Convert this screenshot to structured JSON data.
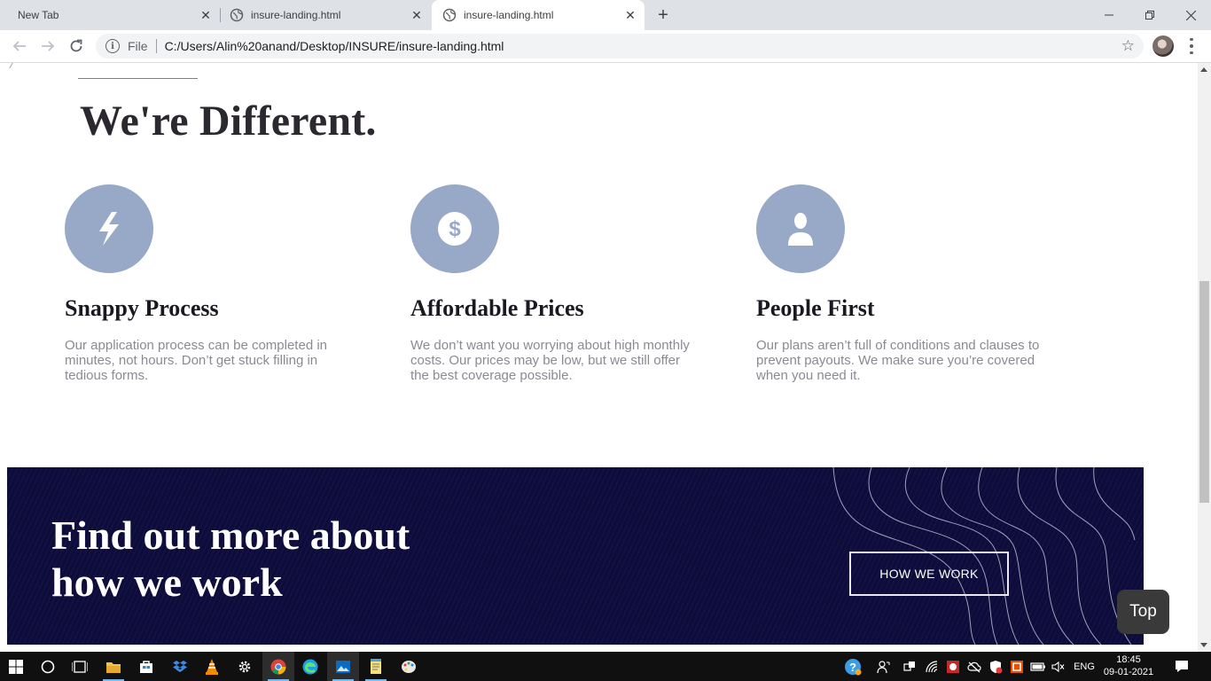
{
  "browser": {
    "tabs": [
      {
        "title": "New Tab"
      },
      {
        "title": "insure-landing.html"
      },
      {
        "title": "insure-landing.html"
      }
    ],
    "address": {
      "scheme_label": "File",
      "url": "C:/Users/Alin%20anand/Desktop/INSURE/insure-landing.html"
    }
  },
  "page": {
    "section_title": "We're Different.",
    "features": [
      {
        "icon": "lightning-icon",
        "title": "Snappy Process",
        "text": "Our application process can be completed in minutes, not hours. Don’t get stuck filling in tedious forms."
      },
      {
        "icon": "dollar-icon",
        "title": "Affordable Prices",
        "text": "We don’t want you worrying about high monthly costs. Our prices may be low, but we still offer the best coverage possible."
      },
      {
        "icon": "person-icon",
        "title": "People First",
        "text": "Our plans aren’t full of conditions and clauses to prevent payouts. We make sure you’re covered when you need it."
      }
    ],
    "cta": {
      "title_line1": "Find out more about",
      "title_line2": "how we work",
      "button": "HOW WE WORK"
    },
    "back_to_top": "Top"
  },
  "taskbar": {
    "language": "ENG",
    "time": "18:45",
    "date": "09-01-2021"
  },
  "colors": {
    "icon_circle": "#97a9c6",
    "cta_background": "#0d0c3d",
    "heading": "#2c2830",
    "body_text": "#8a8a93"
  }
}
